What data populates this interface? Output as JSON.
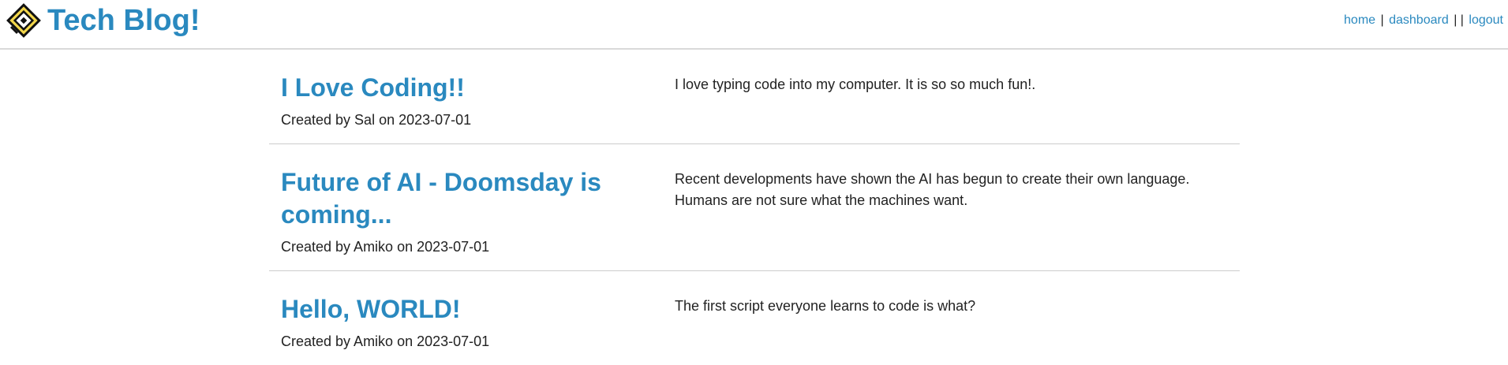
{
  "header": {
    "title": "Tech Blog!",
    "logo_icon": "diamond-logo-icon",
    "nav": {
      "home": "home",
      "dashboard": "dashboard",
      "separator": "|",
      "separator_double": "| |",
      "logout": "logout"
    }
  },
  "posts": [
    {
      "title": "I Love Coding!!",
      "meta": "Created by Sal on 2023-07-01",
      "body": "I love typing code into my computer. It is so so much fun!."
    },
    {
      "title": "Future of AI - Doomsday is coming...",
      "meta": "Created by Amiko on 2023-07-01",
      "body": "Recent developments have shown the AI has begun to create their own language. Humans are not sure what the machines want."
    },
    {
      "title": "Hello, WORLD!",
      "meta": "Created by Amiko on 2023-07-01",
      "body": "The first script everyone learns to code is what?"
    }
  ],
  "colors": {
    "accent": "#2a89bf",
    "text": "#222222",
    "divider": "#cccccc"
  }
}
